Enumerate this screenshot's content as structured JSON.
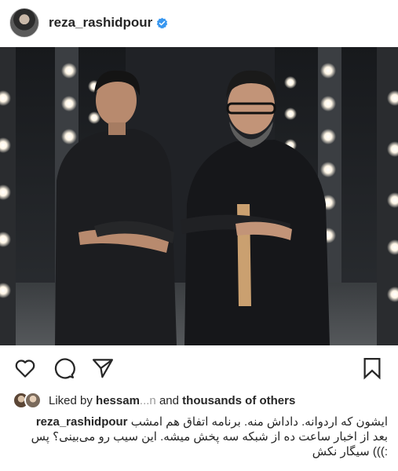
{
  "post": {
    "username": "reza_rashidpour",
    "verified": true,
    "avatar_icon": "profile-avatar",
    "likes": {
      "prefix": "Liked by",
      "first_user": "hessam",
      "first_user_tail": "...n",
      "connector": "and",
      "others": "thousands of others"
    },
    "caption": {
      "username": "reza_rashidpour",
      "text_line1": "ایشون که اردوانه. داداش منه. برنامه اتفاق هم امشب",
      "text_line2": "بعد از اخبار ساعت ده از شبکه سه پخش میشه. این سیب رو می‌بینی؟ پس",
      "text_line3": ":))) سیگار نکش"
    },
    "actions": {
      "like_icon": "heart-icon",
      "comment_icon": "comment-icon",
      "share_icon": "paper-plane-icon",
      "save_icon": "bookmark-icon"
    },
    "colors": {
      "text": "#262626",
      "verified": "#3897f0",
      "background": "#ffffff"
    }
  }
}
